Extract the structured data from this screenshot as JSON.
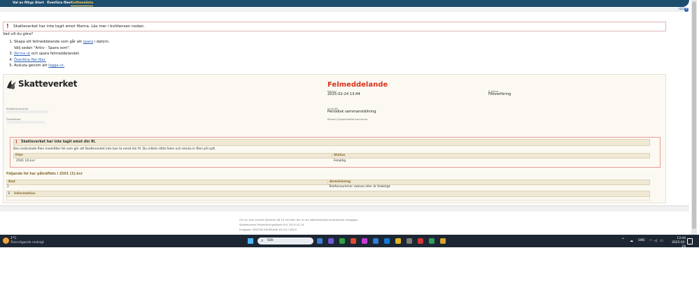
{
  "nav": {
    "tabs": [
      {
        "label": "Val av filtyp"
      },
      {
        "label": "Start"
      },
      {
        "label": "Överföra filer"
      },
      {
        "label": "Kvittenslista"
      }
    ]
  },
  "help": {
    "label": "Hjälp",
    "icon": "help-icon",
    "glyph": "?"
  },
  "alert": {
    "icon": "exclamation-icon",
    "glyph": "!",
    "text": "Skatteverket har inte tagit emot filerna. Läs mer i kvittensen nedan."
  },
  "question": "Vad vill du göra?",
  "steps": [
    {
      "pre": "Skapa ett felmeddelande som går att ",
      "link": "spara",
      "post": " i datorn."
    },
    {
      "pre": "Välj sedan \"Arkiv - Spara som\".",
      "link": "",
      "post": ""
    },
    {
      "pre": "",
      "link": "Skriva ut",
      "post": " och spara felmeddelandet."
    },
    {
      "pre": "",
      "link": "Överföra fler filer.",
      "post": ""
    },
    {
      "pre": "Avsluta genom att ",
      "link": "logga ut.",
      "post": ""
    }
  ],
  "receipt": {
    "logo_text": "Skatteverket",
    "title": "Felmeddelande",
    "datum_label": "Datum",
    "datum_value": "2025-02-24 13:44",
    "etjanst_label": "E-tjänst",
    "etjanst_value": "Filöverföring",
    "kvittensnummer_label": "Kvittensnummer",
    "overforare_label": "Överförare",
    "innehall_label": "Innehåll",
    "innehall_value": "Periodisk sammanställning",
    "person_label": "Person-/Organisationsnummer",
    "error": {
      "icon": "exclamation-icon",
      "glyph": "!",
      "title": "Skatteverket har inte tagit emot din fil.",
      "description": "Den inskickade filen innehåller fel som gör att Skatteverket inte kan ta emot din fil. Du måste rätta felen och skicka in filen på nytt.",
      "col_fil": "Filer",
      "col_status": "Status",
      "file_name": "2501 (3).kvr",
      "file_status": "Felaktig"
    },
    "errors_title": "Följande fel har påträffats i 2501 (3).kvr",
    "errors_table": {
      "col_rad": "Rad",
      "col_anm": "Anmärkning",
      "rows": [
        {
          "rad": "2",
          "anm": "Telefonnummer saknas eller är felaktigt"
        }
      ]
    },
    "info": {
      "icon": "info-icon",
      "glyph": "i",
      "title": "Information"
    }
  },
  "footer": {
    "lines": [
      "Om du inte använt tjänsten på 15 minuter blir du av säkerhetsskäl automatiskt utloggad.",
      "Skatteverket Filöverföringstjänst R/4 2025-02-24",
      "Inloggad: KRISTIN KEVÉRANK 811017-8020"
    ]
  },
  "taskbar": {
    "temp": "1°C",
    "weather": "Övervägande molnigt",
    "search_placeholder": "Sök",
    "lang": "SWE",
    "time": "13:44",
    "date": "2025-02-24",
    "apps": [
      "#3c7fd6",
      "#6c5ad8",
      "#2ea043",
      "#e04c2f",
      "#c53bd8",
      "#2f7ed8",
      "#0f7ad8",
      "#e6b526",
      "#7c7c7c",
      "#d53535",
      "#2f9e58",
      "#d8a52f"
    ]
  },
  "colors": {
    "brand_nav": "#1f4d6e",
    "error_red": "#d8321c",
    "link_blue": "#2a5fb3",
    "receipt_bg": "#fbf9f2"
  }
}
